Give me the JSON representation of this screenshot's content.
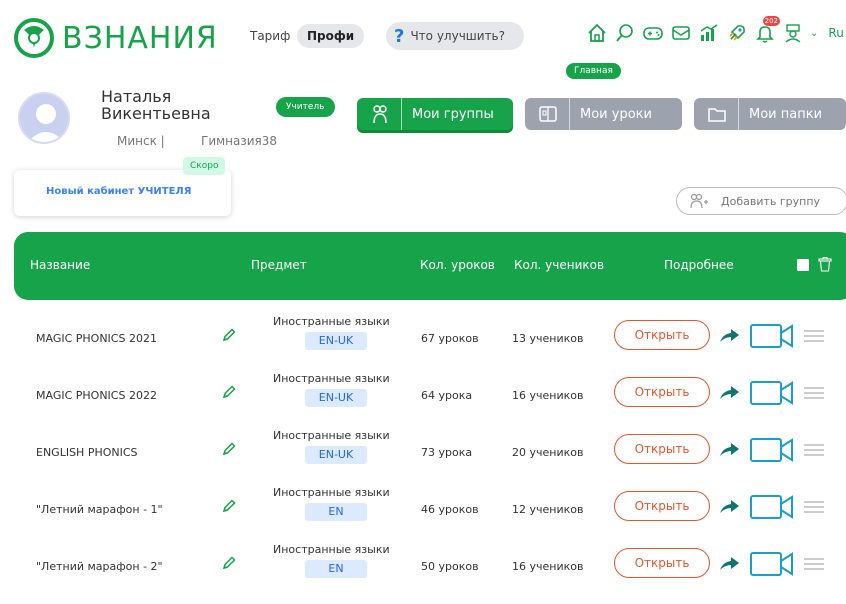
{
  "header": {
    "logo_text": "ВЗНАНИЯ",
    "tariff_label": "Тариф",
    "tariff_value": "Профи",
    "improve_label": "Что улучшить?",
    "notifications_count": "202",
    "language": "Ru",
    "home_tooltip": "Главная"
  },
  "profile": {
    "first_name": "Наталья",
    "last_name": "Викентьевна",
    "city": "Минск  |",
    "school": "Гимназия38",
    "role": "Учитель"
  },
  "tabs": [
    {
      "label": "Мои группы",
      "icon": "groups-icon",
      "active": true
    },
    {
      "label": "Мои уроки",
      "icon": "lessons-book-icon",
      "active": false
    },
    {
      "label": "Мои папки",
      "icon": "folder-icon",
      "active": false
    }
  ],
  "cabinet": {
    "soon_badge": "Скоро",
    "text_prefix": "Новый кабинет",
    "text_highlight": "УЧИТЕЛЯ"
  },
  "add_group_label": "Добавить группу",
  "table": {
    "headers": {
      "name": "Название",
      "subject": "Предмет",
      "lessons": "Кол. уроков",
      "students": "Кол. учеников",
      "details": "Подробнее"
    },
    "open_label": "Открыть",
    "rows": [
      {
        "name": "MAGIC PHONICS 2021",
        "subject": "Иностранные языки",
        "lang": "EN-UK",
        "lessons": "67 уроков",
        "students": "13 учеников"
      },
      {
        "name": "MAGIC PHONICS 2022",
        "subject": "Иностранные языки",
        "lang": "EN-UK",
        "lessons": "64 урока",
        "students": "16 учеников"
      },
      {
        "name": "ENGLISH PHONICS",
        "subject": "Иностранные языки",
        "lang": "EN-UK",
        "lessons": "73 урока",
        "students": "20 учеников"
      },
      {
        "name": "\"Летний марафон - 1\"",
        "subject": "Иностранные языки",
        "lang": "EN",
        "lessons": "46 уроков",
        "students": "12 учеников"
      },
      {
        "name": "\"Летний марафон - 2\"",
        "subject": "Иностранные языки",
        "lang": "EN",
        "lessons": "50 уроков",
        "students": "16 учеников"
      }
    ]
  },
  "colors": {
    "brand_green": "#16a34a",
    "open_orange": "#e8562a",
    "video_blue": "#1a9fc9",
    "inactive_tab": "#9ca3af"
  }
}
